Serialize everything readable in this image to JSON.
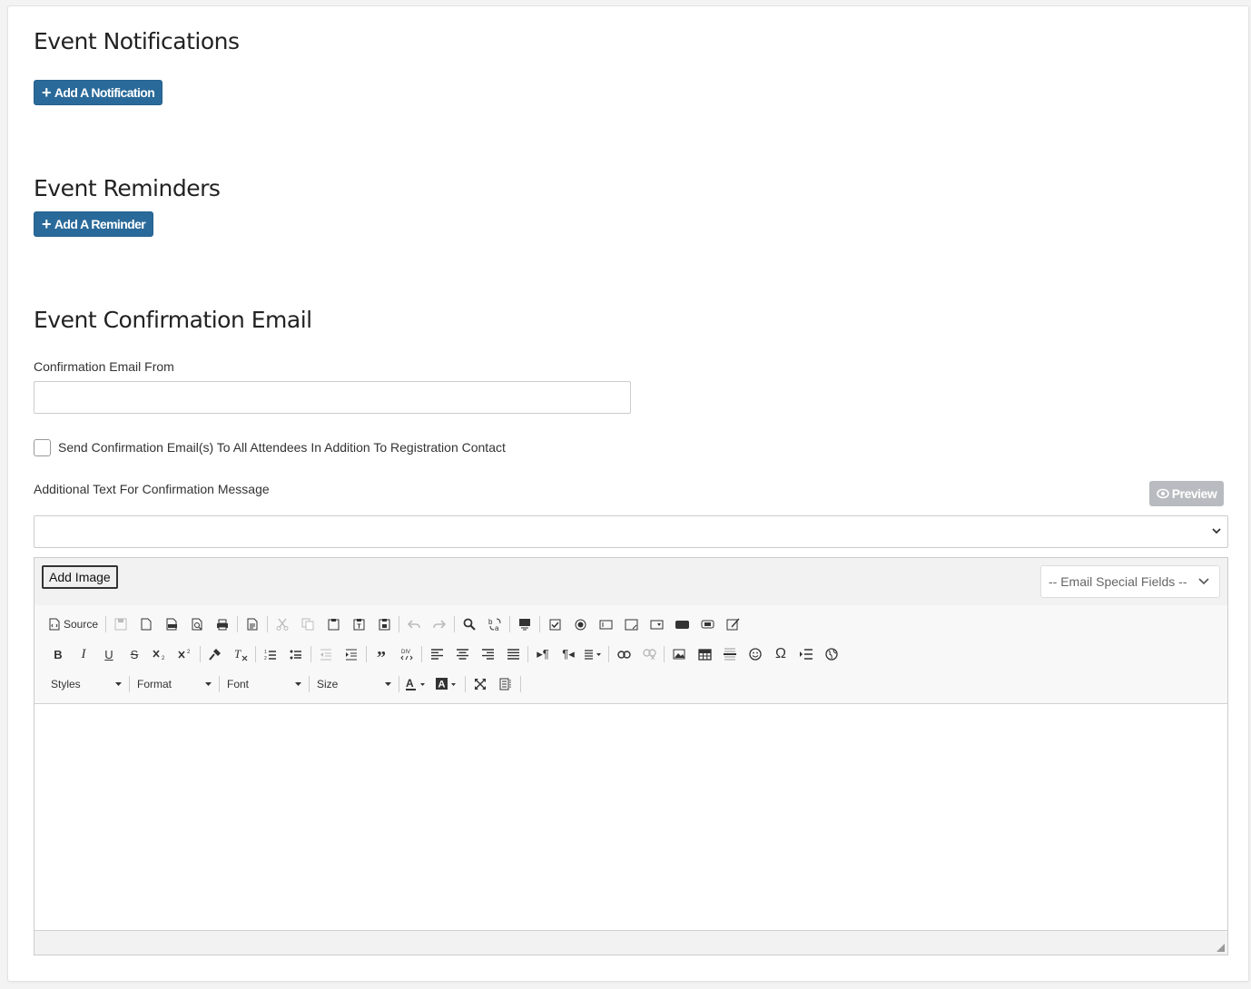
{
  "notifications": {
    "heading": "Event Notifications",
    "button_label": "Add A Notification"
  },
  "reminders": {
    "heading": "Event Reminders",
    "button_label": "Add A Reminder"
  },
  "confirmation": {
    "heading": "Event Confirmation Email",
    "from_label": "Confirmation Email From",
    "from_value": "",
    "send_all_label": "Send Confirmation Email(s) To All Attendees In Addition To Registration Contact",
    "send_all_checked": false,
    "additional_text_label": "Additional Text For Confirmation Message",
    "preview_label": "Preview",
    "template_select_value": ""
  },
  "editor": {
    "add_image_label": "Add Image",
    "email_special_fields_label": "-- Email Special Fields --",
    "source_label": "Source",
    "styles_label": "Styles",
    "format_label": "Format",
    "font_label": "Font",
    "size_label": "Size"
  },
  "colors": {
    "primary_button": "#2a6a9a",
    "disabled_button": "#b8bcc0"
  }
}
